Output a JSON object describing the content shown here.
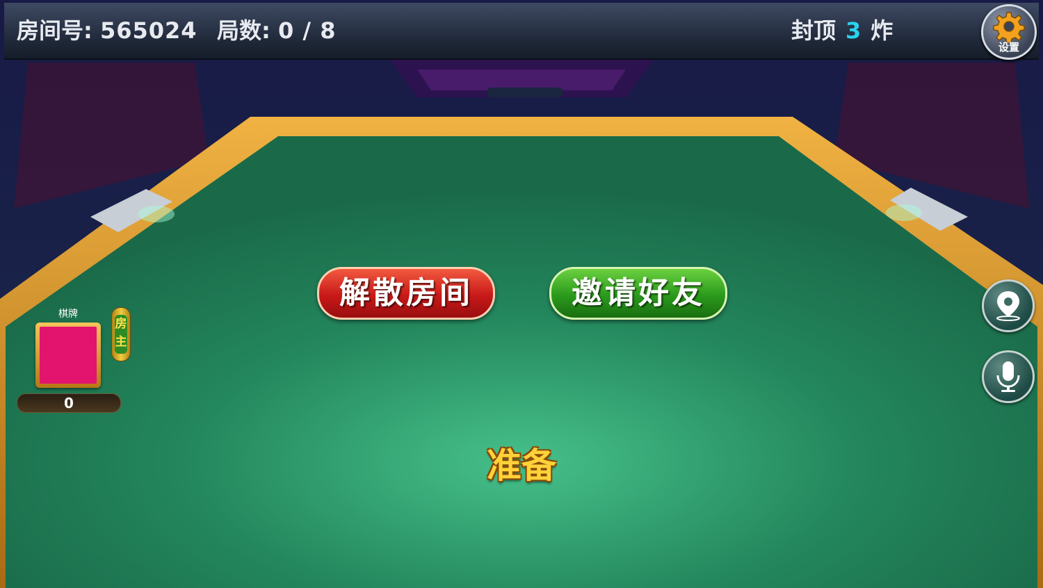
{
  "header": {
    "room_label": "房间号:",
    "room_number": "565024",
    "rounds_label": "局数:",
    "rounds_value": "0 / 8",
    "cap_label": "封顶",
    "cap_value": "3",
    "cap_unit": "炸"
  },
  "settings": {
    "label": "设置",
    "icon": "gear-icon"
  },
  "side_buttons": {
    "location_icon": "location-pin-icon",
    "voice_icon": "microphone-icon"
  },
  "actions": {
    "dismiss_room": "解散房间",
    "invite_friends": "邀请好友",
    "ready": "准备"
  },
  "player": {
    "name": "棋牌",
    "owner_badge": "房主",
    "score": "0",
    "avatar_color": "#e2146e"
  },
  "colors": {
    "felt": "#1d6e4e",
    "cap_accent": "#29d3ee",
    "dismiss_red": "#c81918",
    "invite_green": "#2a9a1c",
    "ready_gold": "#ffd23a"
  }
}
